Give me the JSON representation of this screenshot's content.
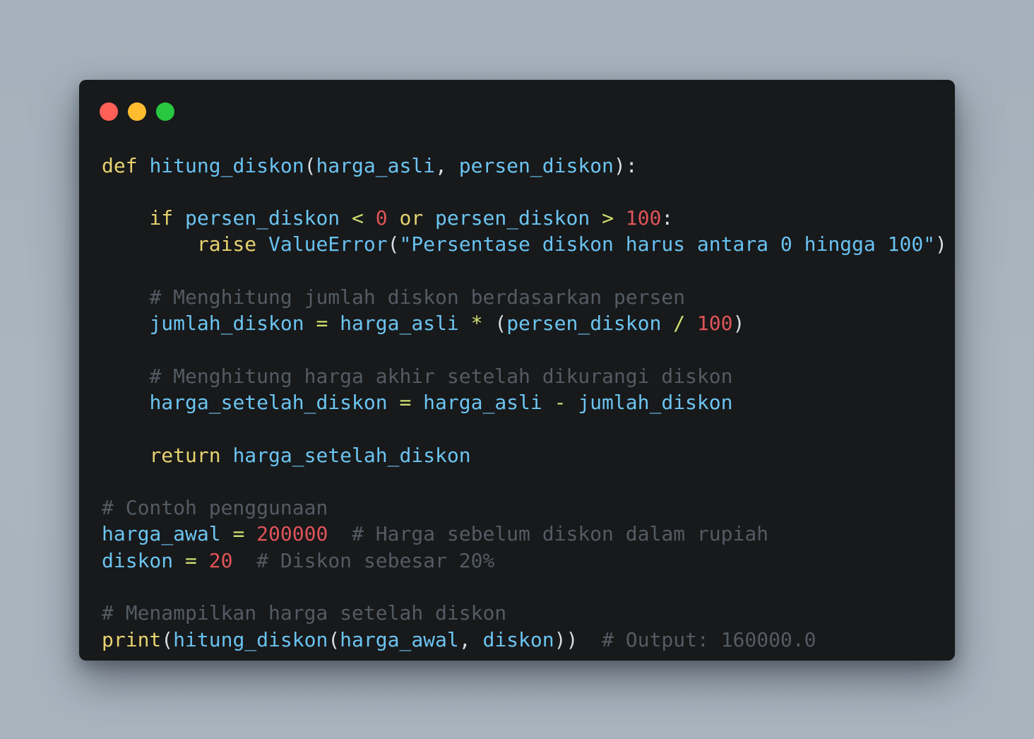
{
  "window": {
    "controls": [
      {
        "name": "close",
        "color": "#fe5f57"
      },
      {
        "name": "minimize",
        "color": "#febc2e"
      },
      {
        "name": "zoom",
        "color": "#28c840"
      }
    ]
  },
  "code": {
    "language": "python",
    "lines": [
      [
        {
          "t": "def",
          "c": "kw"
        },
        {
          "t": " ",
          "c": "pl"
        },
        {
          "t": "hitung_diskon",
          "c": "fn"
        },
        {
          "t": "(",
          "c": "pl"
        },
        {
          "t": "harga_asli",
          "c": "var"
        },
        {
          "t": ", ",
          "c": "pl"
        },
        {
          "t": "persen_diskon",
          "c": "var"
        },
        {
          "t": "):",
          "c": "pl"
        }
      ],
      [],
      [
        {
          "t": "    ",
          "c": "pl"
        },
        {
          "t": "if",
          "c": "kw"
        },
        {
          "t": " ",
          "c": "pl"
        },
        {
          "t": "persen_diskon",
          "c": "var"
        },
        {
          "t": " ",
          "c": "pl"
        },
        {
          "t": "<",
          "c": "op-y"
        },
        {
          "t": " ",
          "c": "pl"
        },
        {
          "t": "0",
          "c": "num"
        },
        {
          "t": " ",
          "c": "pl"
        },
        {
          "t": "or",
          "c": "kw"
        },
        {
          "t": " ",
          "c": "pl"
        },
        {
          "t": "persen_diskon",
          "c": "var"
        },
        {
          "t": " ",
          "c": "pl"
        },
        {
          "t": ">",
          "c": "op-y"
        },
        {
          "t": " ",
          "c": "pl"
        },
        {
          "t": "100",
          "c": "num"
        },
        {
          "t": ":",
          "c": "pl"
        }
      ],
      [
        {
          "t": "        ",
          "c": "pl"
        },
        {
          "t": "raise",
          "c": "kw"
        },
        {
          "t": " ",
          "c": "pl"
        },
        {
          "t": "ValueError",
          "c": "fn"
        },
        {
          "t": "(",
          "c": "pl"
        },
        {
          "t": "\"Persentase diskon harus antara 0 hingga 100\"",
          "c": "str"
        },
        {
          "t": ")",
          "c": "pl"
        }
      ],
      [],
      [
        {
          "t": "    ",
          "c": "pl"
        },
        {
          "t": "# Menghitung jumlah diskon berdasarkan persen",
          "c": "cm"
        }
      ],
      [
        {
          "t": "    ",
          "c": "pl"
        },
        {
          "t": "jumlah_diskon",
          "c": "var"
        },
        {
          "t": " ",
          "c": "pl"
        },
        {
          "t": "=",
          "c": "op-y"
        },
        {
          "t": " ",
          "c": "pl"
        },
        {
          "t": "harga_asli",
          "c": "var"
        },
        {
          "t": " ",
          "c": "pl"
        },
        {
          "t": "*",
          "c": "op-y"
        },
        {
          "t": " (",
          "c": "pl"
        },
        {
          "t": "persen_diskon",
          "c": "var"
        },
        {
          "t": " ",
          "c": "pl"
        },
        {
          "t": "/",
          "c": "op-y"
        },
        {
          "t": " ",
          "c": "pl"
        },
        {
          "t": "100",
          "c": "num"
        },
        {
          "t": ")",
          "c": "pl"
        }
      ],
      [],
      [
        {
          "t": "    ",
          "c": "pl"
        },
        {
          "t": "# Menghitung harga akhir setelah dikurangi diskon",
          "c": "cm"
        }
      ],
      [
        {
          "t": "    ",
          "c": "pl"
        },
        {
          "t": "harga_setelah_diskon",
          "c": "var"
        },
        {
          "t": " ",
          "c": "pl"
        },
        {
          "t": "=",
          "c": "op-y"
        },
        {
          "t": " ",
          "c": "pl"
        },
        {
          "t": "harga_asli",
          "c": "var"
        },
        {
          "t": " ",
          "c": "pl"
        },
        {
          "t": "-",
          "c": "op-y"
        },
        {
          "t": " ",
          "c": "pl"
        },
        {
          "t": "jumlah_diskon",
          "c": "var"
        }
      ],
      [],
      [
        {
          "t": "    ",
          "c": "pl"
        },
        {
          "t": "return",
          "c": "kw"
        },
        {
          "t": " ",
          "c": "pl"
        },
        {
          "t": "harga_setelah_diskon",
          "c": "var"
        }
      ],
      [],
      [
        {
          "t": "# Contoh penggunaan",
          "c": "cm"
        }
      ],
      [
        {
          "t": "harga_awal",
          "c": "var"
        },
        {
          "t": " ",
          "c": "pl"
        },
        {
          "t": "=",
          "c": "op-y"
        },
        {
          "t": " ",
          "c": "pl"
        },
        {
          "t": "200000",
          "c": "num"
        },
        {
          "t": "  ",
          "c": "pl"
        },
        {
          "t": "# Harga sebelum diskon dalam rupiah",
          "c": "cm"
        }
      ],
      [
        {
          "t": "diskon",
          "c": "var"
        },
        {
          "t": " ",
          "c": "pl"
        },
        {
          "t": "=",
          "c": "op-y"
        },
        {
          "t": " ",
          "c": "pl"
        },
        {
          "t": "20",
          "c": "num"
        },
        {
          "t": "  ",
          "c": "pl"
        },
        {
          "t": "# Diskon sebesar 20%",
          "c": "cm"
        }
      ],
      [],
      [
        {
          "t": "# Menampilkan harga setelah diskon",
          "c": "cm"
        }
      ],
      [
        {
          "t": "print",
          "c": "kw"
        },
        {
          "t": "(",
          "c": "pl"
        },
        {
          "t": "hitung_diskon",
          "c": "fn"
        },
        {
          "t": "(",
          "c": "pl"
        },
        {
          "t": "harga_awal",
          "c": "var"
        },
        {
          "t": ", ",
          "c": "pl"
        },
        {
          "t": "diskon",
          "c": "var"
        },
        {
          "t": "))",
          "c": "pl"
        },
        {
          "t": "  ",
          "c": "pl"
        },
        {
          "t": "# Output: 160000.0",
          "c": "cm"
        }
      ]
    ]
  }
}
